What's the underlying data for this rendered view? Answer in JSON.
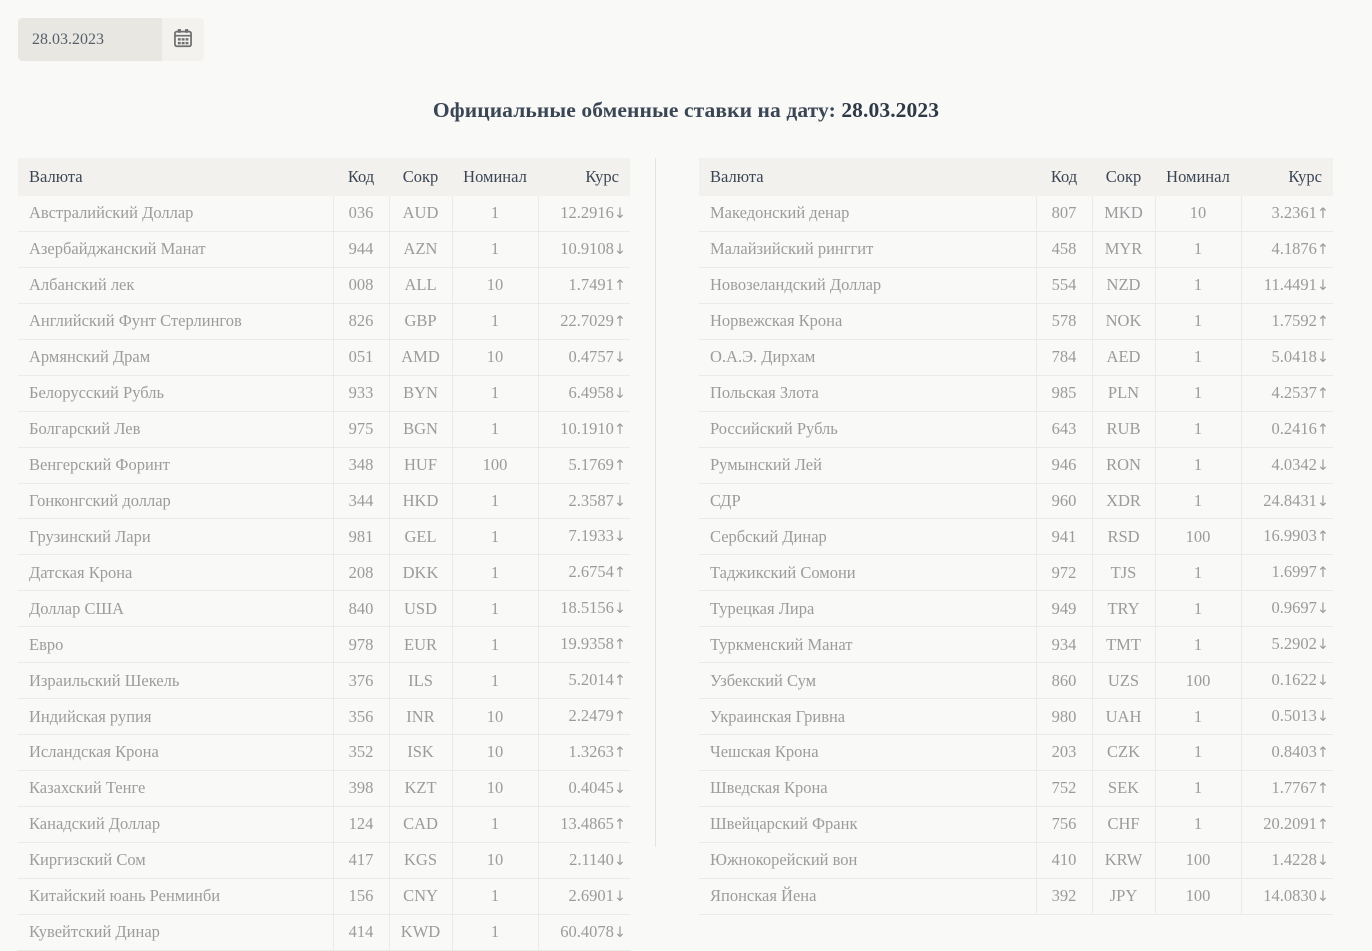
{
  "datepicker": {
    "value": "28.03.2023",
    "placeholder": "дд.мм.гггг",
    "icon": "calendar-icon"
  },
  "title": {
    "prefix": "Официальные обменные ставки на дату: ",
    "date": "28.03.2023"
  },
  "colors": {
    "up": "#2aa58a",
    "down": "#f0522a",
    "page_bg": "#f9f9f8",
    "header_bg": "#f2f1ee",
    "text": "#9b9b9b",
    "title_text": "#3b4654"
  },
  "columns": [
    "Валюта",
    "Код",
    "Сокр",
    "Номинал",
    "Курс"
  ],
  "tables": [
    {
      "name": "left-rates-table",
      "rows": [
        {
          "name": "Австралийский Доллар",
          "code": "036",
          "abbr": "AUD",
          "nominal": "1",
          "rate": "12.2916",
          "dir": "down"
        },
        {
          "name": "Азербайджанский Манат",
          "code": "944",
          "abbr": "AZN",
          "nominal": "1",
          "rate": "10.9108",
          "dir": "down"
        },
        {
          "name": "Албанский лек",
          "code": "008",
          "abbr": "ALL",
          "nominal": "10",
          "rate": "1.7491",
          "dir": "up"
        },
        {
          "name": "Английский Фунт Стерлингов",
          "code": "826",
          "abbr": "GBP",
          "nominal": "1",
          "rate": "22.7029",
          "dir": "up"
        },
        {
          "name": "Армянский Драм",
          "code": "051",
          "abbr": "AMD",
          "nominal": "10",
          "rate": "0.4757",
          "dir": "down"
        },
        {
          "name": "Белорусский Рубль",
          "code": "933",
          "abbr": "BYN",
          "nominal": "1",
          "rate": "6.4958",
          "dir": "down"
        },
        {
          "name": "Болгарский Лев",
          "code": "975",
          "abbr": "BGN",
          "nominal": "1",
          "rate": "10.1910",
          "dir": "up"
        },
        {
          "name": "Венгерский Форинт",
          "code": "348",
          "abbr": "HUF",
          "nominal": "100",
          "rate": "5.1769",
          "dir": "up"
        },
        {
          "name": "Гонконгский доллар",
          "code": "344",
          "abbr": "HKD",
          "nominal": "1",
          "rate": "2.3587",
          "dir": "down"
        },
        {
          "name": "Грузинский Лари",
          "code": "981",
          "abbr": "GEL",
          "nominal": "1",
          "rate": "7.1933",
          "dir": "down"
        },
        {
          "name": "Датская Крона",
          "code": "208",
          "abbr": "DKK",
          "nominal": "1",
          "rate": "2.6754",
          "dir": "up"
        },
        {
          "name": "Доллар США",
          "code": "840",
          "abbr": "USD",
          "nominal": "1",
          "rate": "18.5156",
          "dir": "down"
        },
        {
          "name": "Евро",
          "code": "978",
          "abbr": "EUR",
          "nominal": "1",
          "rate": "19.9358",
          "dir": "up"
        },
        {
          "name": "Израильский Шекель",
          "code": "376",
          "abbr": "ILS",
          "nominal": "1",
          "rate": "5.2014",
          "dir": "up"
        },
        {
          "name": "Индийская рупия",
          "code": "356",
          "abbr": "INR",
          "nominal": "10",
          "rate": "2.2479",
          "dir": "up"
        },
        {
          "name": "Исландская Крона",
          "code": "352",
          "abbr": "ISK",
          "nominal": "10",
          "rate": "1.3263",
          "dir": "up"
        },
        {
          "name": "Казахский Тенге",
          "code": "398",
          "abbr": "KZT",
          "nominal": "10",
          "rate": "0.4045",
          "dir": "down"
        },
        {
          "name": "Канадский Доллар",
          "code": "124",
          "abbr": "CAD",
          "nominal": "1",
          "rate": "13.4865",
          "dir": "up"
        },
        {
          "name": "Киргизский Сом",
          "code": "417",
          "abbr": "KGS",
          "nominal": "10",
          "rate": "2.1140",
          "dir": "down"
        },
        {
          "name": "Китайский юань Ренминби",
          "code": "156",
          "abbr": "CNY",
          "nominal": "1",
          "rate": "2.6901",
          "dir": "down"
        },
        {
          "name": "Кувейтский Динар",
          "code": "414",
          "abbr": "KWD",
          "nominal": "1",
          "rate": "60.4078",
          "dir": "down"
        }
      ]
    },
    {
      "name": "right-rates-table",
      "rows": [
        {
          "name": "Македонский денар",
          "code": "807",
          "abbr": "MKD",
          "nominal": "10",
          "rate": "3.2361",
          "dir": "up"
        },
        {
          "name": "Малайзийский ринггит",
          "code": "458",
          "abbr": "MYR",
          "nominal": "1",
          "rate": "4.1876",
          "dir": "up"
        },
        {
          "name": "Новозеландский Доллар",
          "code": "554",
          "abbr": "NZD",
          "nominal": "1",
          "rate": "11.4491",
          "dir": "down"
        },
        {
          "name": "Норвежская Крона",
          "code": "578",
          "abbr": "NOK",
          "nominal": "1",
          "rate": "1.7592",
          "dir": "up"
        },
        {
          "name": "О.А.Э. Дирхам",
          "code": "784",
          "abbr": "AED",
          "nominal": "1",
          "rate": "5.0418",
          "dir": "down"
        },
        {
          "name": "Польская Злота",
          "code": "985",
          "abbr": "PLN",
          "nominal": "1",
          "rate": "4.2537",
          "dir": "up"
        },
        {
          "name": "Российский Рубль",
          "code": "643",
          "abbr": "RUB",
          "nominal": "1",
          "rate": "0.2416",
          "dir": "up"
        },
        {
          "name": "Румынский Лей",
          "code": "946",
          "abbr": "RON",
          "nominal": "1",
          "rate": "4.0342",
          "dir": "down"
        },
        {
          "name": "СДР",
          "code": "960",
          "abbr": "XDR",
          "nominal": "1",
          "rate": "24.8431",
          "dir": "down"
        },
        {
          "name": "Сербский Динар",
          "code": "941",
          "abbr": "RSD",
          "nominal": "100",
          "rate": "16.9903",
          "dir": "up"
        },
        {
          "name": "Таджикский Сомони",
          "code": "972",
          "abbr": "TJS",
          "nominal": "1",
          "rate": "1.6997",
          "dir": "up"
        },
        {
          "name": "Турецкая Лира",
          "code": "949",
          "abbr": "TRY",
          "nominal": "1",
          "rate": "0.9697",
          "dir": "down"
        },
        {
          "name": "Туркменский Манат",
          "code": "934",
          "abbr": "TMT",
          "nominal": "1",
          "rate": "5.2902",
          "dir": "down"
        },
        {
          "name": "Узбекский Сум",
          "code": "860",
          "abbr": "UZS",
          "nominal": "100",
          "rate": "0.1622",
          "dir": "down"
        },
        {
          "name": "Украинская Гривна",
          "code": "980",
          "abbr": "UAH",
          "nominal": "1",
          "rate": "0.5013",
          "dir": "down"
        },
        {
          "name": "Чешская Крона",
          "code": "203",
          "abbr": "CZK",
          "nominal": "1",
          "rate": "0.8403",
          "dir": "up"
        },
        {
          "name": "Шведская Крона",
          "code": "752",
          "abbr": "SEK",
          "nominal": "1",
          "rate": "1.7767",
          "dir": "up"
        },
        {
          "name": "Швейцарский Франк",
          "code": "756",
          "abbr": "CHF",
          "nominal": "1",
          "rate": "20.2091",
          "dir": "up"
        },
        {
          "name": "Южнокорейский вон",
          "code": "410",
          "abbr": "KRW",
          "nominal": "100",
          "rate": "1.4228",
          "dir": "down"
        },
        {
          "name": "Японская Йена",
          "code": "392",
          "abbr": "JPY",
          "nominal": "100",
          "rate": "14.0830",
          "dir": "down"
        }
      ]
    }
  ]
}
